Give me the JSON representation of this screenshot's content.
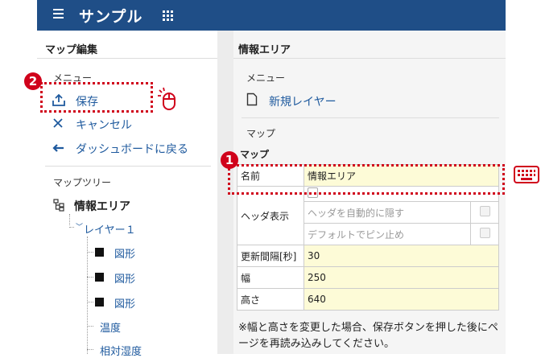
{
  "header": {
    "title": "サンプル",
    "menu_icon": "hamburger-icon",
    "apps_icon": "grid-icon"
  },
  "left": {
    "title": "マップ編集",
    "menu_section": "メニュー",
    "menu": [
      {
        "label": "保存",
        "icon": "upload-icon"
      },
      {
        "label": "キャンセル",
        "icon": "close-icon"
      },
      {
        "label": "ダッシュボードに戻る",
        "icon": "back-arrow-icon"
      }
    ],
    "tree_section": "マップツリー",
    "tree": {
      "root": "情報エリア",
      "layer": "レイヤー１",
      "items": [
        "図形",
        "図形",
        "図形",
        "温度",
        "相対湿度"
      ]
    }
  },
  "right": {
    "title": "情報エリア",
    "menu_section": "メニュー",
    "new_layer": "新規レイヤー",
    "map_section": "マップ",
    "form": {
      "heading": "マップ",
      "name_label": "名前",
      "name_value": "情報エリア",
      "header_label": "ヘッダ表示",
      "auto_hide": "ヘッダを自動的に隠す",
      "pin_default": "デフォルトでピン止め",
      "interval_label": "更新間隔[秒]",
      "interval_value": "30",
      "width_label": "幅",
      "width_value": "250",
      "height_label": "高さ",
      "height_value": "640"
    },
    "note": "※幅と高さを変更した場合、保存ボタンを押した後にページを再読み込みしてください。"
  },
  "annotations": {
    "badge1": "1",
    "badge2": "2"
  },
  "colors": {
    "header": "#1f4e87",
    "accent": "#1f5a9e",
    "highlight": "#d0021b",
    "input": "#fdfbd7"
  }
}
